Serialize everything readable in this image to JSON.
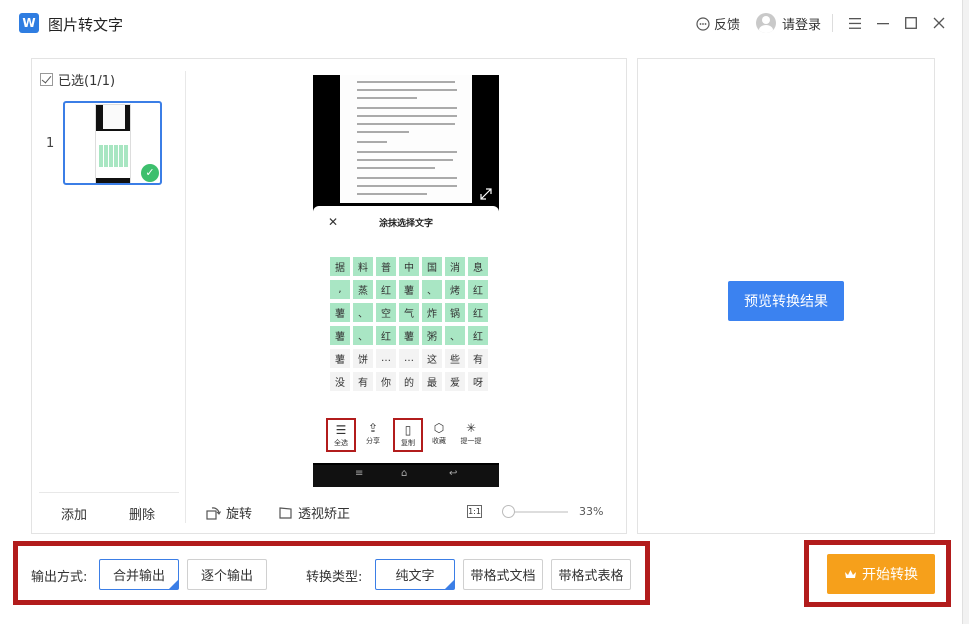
{
  "app": {
    "title": "图片转文字",
    "logo_letter": "W"
  },
  "titlebar": {
    "feedback": "反馈",
    "login": "请登录",
    "icons": [
      "feedback-icon",
      "avatar",
      "menu-icon",
      "minimize-icon",
      "maximize-icon",
      "close-icon"
    ]
  },
  "thumbnails": {
    "selected_label": "已选(1/1)",
    "items": [
      {
        "index": "1",
        "selected": true
      }
    ],
    "add": "添加",
    "delete": "删除"
  },
  "preview": {
    "sheet_title": "涂抹选择文字",
    "char_rows": [
      [
        "据",
        "料",
        "普",
        "中",
        "国",
        "消",
        "息"
      ],
      [
        ",",
        "蒸",
        "红",
        "薯",
        "、",
        "烤",
        "红"
      ],
      [
        "薯",
        "、",
        "空",
        "气",
        "炸",
        "锅",
        "红"
      ],
      [
        "薯",
        "、",
        "红",
        "薯",
        "粥",
        "、",
        "红"
      ],
      [
        "薯",
        "饼",
        "…",
        "…",
        "这",
        "些",
        "有"
      ],
      [
        "没",
        "有",
        "你",
        "的",
        "最",
        "爱",
        "呀"
      ]
    ],
    "green_rows": 4,
    "actions": [
      "全选",
      "分享",
      "复制",
      "收藏",
      "提一提"
    ],
    "tools": {
      "rotate": "旋转",
      "perspective": "透视矫正",
      "fit": "1:1",
      "zoom": "33%"
    }
  },
  "right": {
    "preview_button": "预览转换结果"
  },
  "options": {
    "output_label": "输出方式:",
    "merge_output": "合并输出",
    "single_output": "逐个输出",
    "type_label": "转换类型:",
    "plain_text": "纯文字",
    "formatted_doc": "带格式文档",
    "formatted_table": "带格式表格"
  },
  "start": {
    "label": "开始转换"
  },
  "colors": {
    "accent": "#3b82f0",
    "start": "#f6a01b",
    "highlight": "#b21c1c",
    "green": "#a9e6c4"
  }
}
